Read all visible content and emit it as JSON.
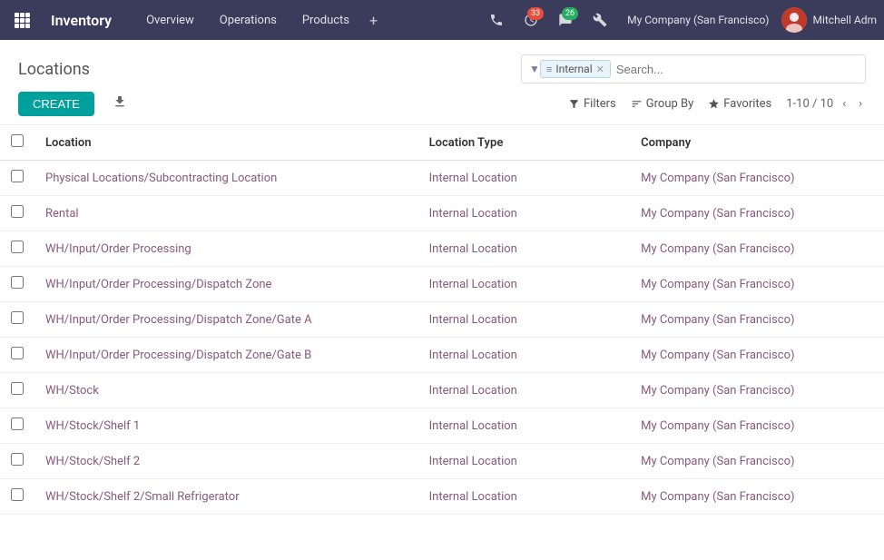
{
  "app": {
    "title": "Inventory"
  },
  "navbar": {
    "menu_items": [
      "Overview",
      "Operations",
      "Products"
    ],
    "plus_label": "+",
    "notifications_count": "33",
    "messages_count": "26",
    "company": "My Company (San Francisco)",
    "user": "Mitchell Adm"
  },
  "page": {
    "title": "Locations",
    "search_tag": "Internal",
    "search_placeholder": "Search..."
  },
  "toolbar": {
    "create_label": "CREATE",
    "filters_label": "Filters",
    "groupby_label": "Group By",
    "favorites_label": "Favorites",
    "pagination": "1-10 / 10"
  },
  "table": {
    "headers": [
      "Location",
      "Location Type",
      "Company"
    ],
    "rows": [
      {
        "location": "Physical Locations/Subcontracting Location",
        "location_type": "Internal Location",
        "company": "My Company (San Francisco)"
      },
      {
        "location": "Rental",
        "location_type": "Internal Location",
        "company": "My Company (San Francisco)"
      },
      {
        "location": "WH/Input/Order Processing",
        "location_type": "Internal Location",
        "company": "My Company (San Francisco)"
      },
      {
        "location": "WH/Input/Order Processing/Dispatch Zone",
        "location_type": "Internal Location",
        "company": "My Company (San Francisco)"
      },
      {
        "location": "WH/Input/Order Processing/Dispatch Zone/Gate A",
        "location_type": "Internal Location",
        "company": "My Company (San Francisco)"
      },
      {
        "location": "WH/Input/Order Processing/Dispatch Zone/Gate B",
        "location_type": "Internal Location",
        "company": "My Company (San Francisco)"
      },
      {
        "location": "WH/Stock",
        "location_type": "Internal Location",
        "company": "My Company (San Francisco)"
      },
      {
        "location": "WH/Stock/Shelf 1",
        "location_type": "Internal Location",
        "company": "My Company (San Francisco)"
      },
      {
        "location": "WH/Stock/Shelf 2",
        "location_type": "Internal Location",
        "company": "My Company (San Francisco)"
      },
      {
        "location": "WH/Stock/Shelf 2/Small Refrigerator",
        "location_type": "Internal Location",
        "company": "My Company (San Francisco)"
      }
    ]
  }
}
